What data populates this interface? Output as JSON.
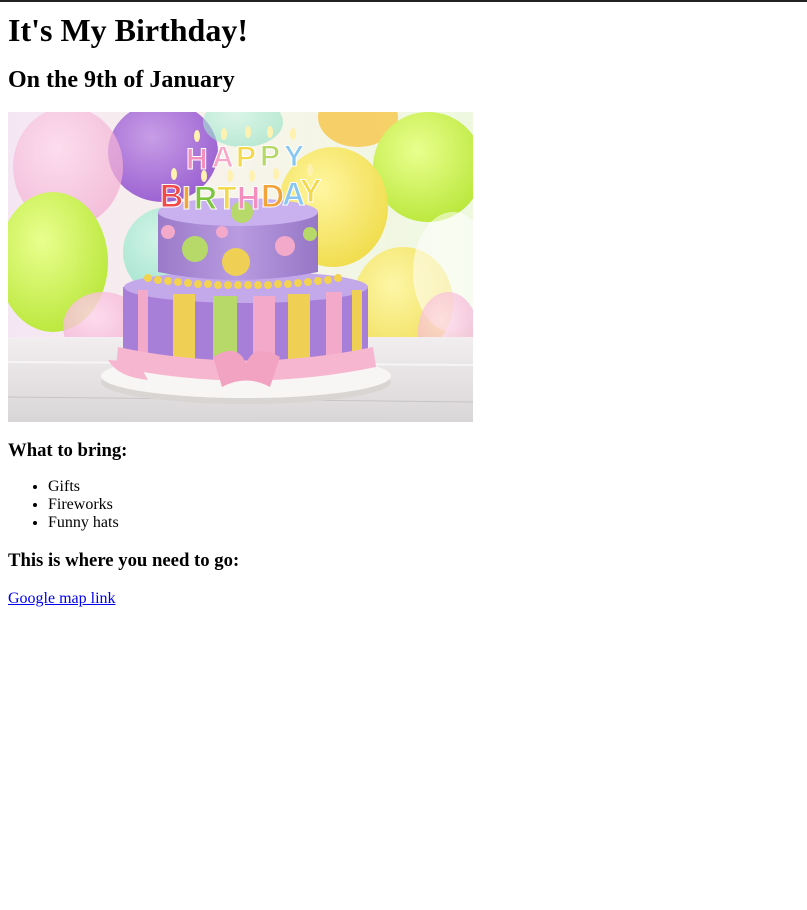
{
  "title": "It's My Birthday!",
  "subtitle": "On the 9th of January",
  "image": {
    "cake_letters_top": [
      "H",
      "A",
      "P",
      "P",
      "Y"
    ],
    "cake_letters_bottom": [
      "B",
      "I",
      "R",
      "T",
      "H",
      "D",
      "A",
      "Y"
    ]
  },
  "bring": {
    "heading": "What to bring:",
    "items": [
      "Gifts",
      "Fireworks",
      "Funny hats"
    ]
  },
  "directions": {
    "heading": "This is where you need to go:",
    "link_text": "Google map link"
  },
  "colors": {
    "link": "#0000ee",
    "top_border": "#222222"
  }
}
